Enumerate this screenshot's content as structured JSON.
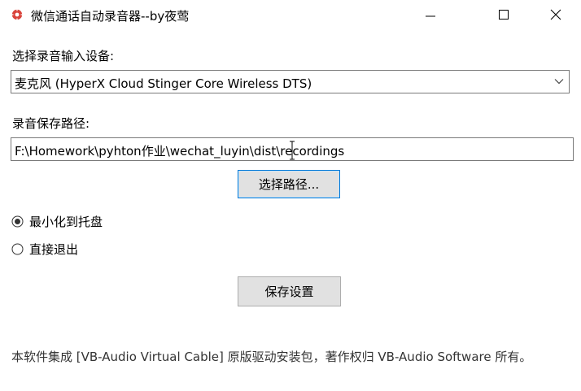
{
  "window": {
    "title": "微信通话自动录音器--by夜莺",
    "minimize_symbol": "—",
    "maximize_symbol": "☐",
    "close_symbol": "✕",
    "app_icon": "red-gear-icon"
  },
  "device": {
    "label": "选择录音输入设备:",
    "selected": "麦克风 (HyperX Cloud Stinger Core Wireless DTS)"
  },
  "path": {
    "label": "录音保存路径:",
    "value": "F:\\Homework\\pyhton作业\\wechat_luyin\\dist\\recordings",
    "browse_button": "选择路径..."
  },
  "close_action": {
    "options": [
      {
        "label": "最小化到托盘",
        "selected": true
      },
      {
        "label": "直接退出",
        "selected": false
      }
    ]
  },
  "save_button": "保存设置",
  "footer": "本软件集成 [VB-Audio Virtual Cable] 原版驱动安装包，著作权归 VB-Audio Software 所有。",
  "colors": {
    "accent": "#0078d7",
    "icon_red": "#d9433b",
    "button_bg": "#e1e1e1"
  }
}
